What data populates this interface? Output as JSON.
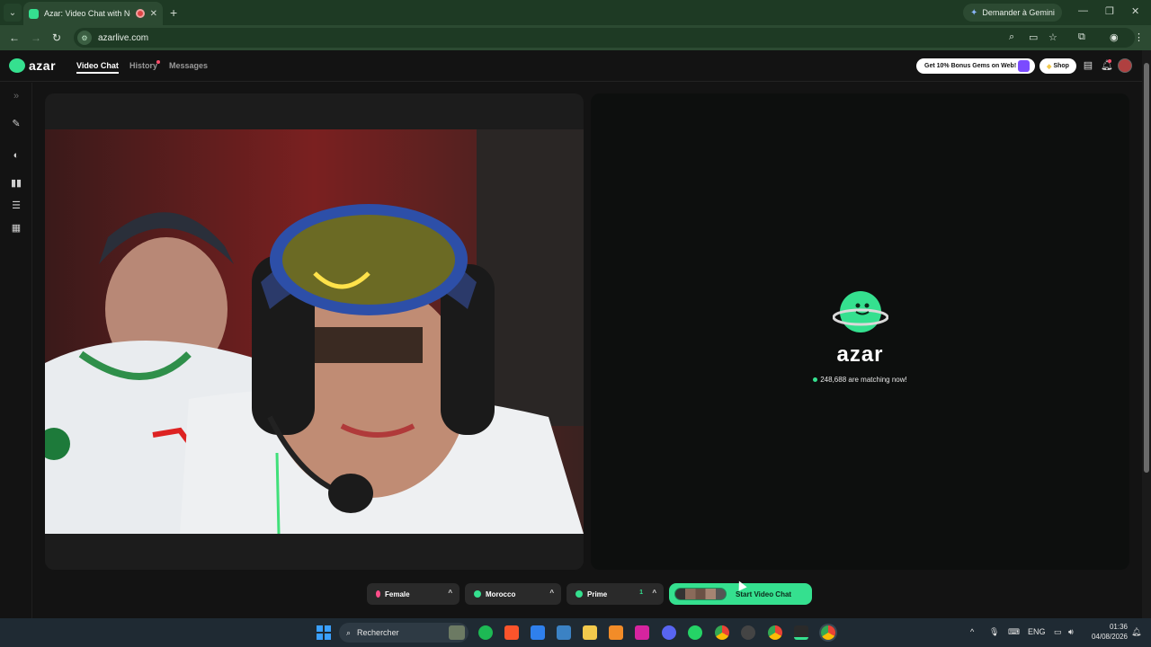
{
  "browser": {
    "tab_title": "Azar: Video Chat with New",
    "new_tab": "+",
    "gemini_label": "Demander à Gemini",
    "url": "azarlive.com"
  },
  "app": {
    "logo_text": "azar",
    "nav": {
      "video_chat": "Video Chat",
      "history": "History",
      "messages": "Messages"
    },
    "promo_label": "Get 10% Bonus Gems on Web!",
    "shop_label": "Shop",
    "center_logo_text": "azar",
    "matching_text": "248,688 are matching now!",
    "filters": {
      "gender": "Female",
      "country": "Morocco",
      "prime": "Prime",
      "prime_count": "1"
    },
    "start_label": "Start Video Chat"
  },
  "taskbar": {
    "search_placeholder": "Rechercher",
    "lang": "ENG",
    "time": "01:36",
    "date": "04/08/2026"
  },
  "colors": {
    "accent": "#35e08f",
    "chrome_dark": "#1e3a24",
    "chrome_mid": "#2c4a32",
    "app_bg": "#131313"
  }
}
